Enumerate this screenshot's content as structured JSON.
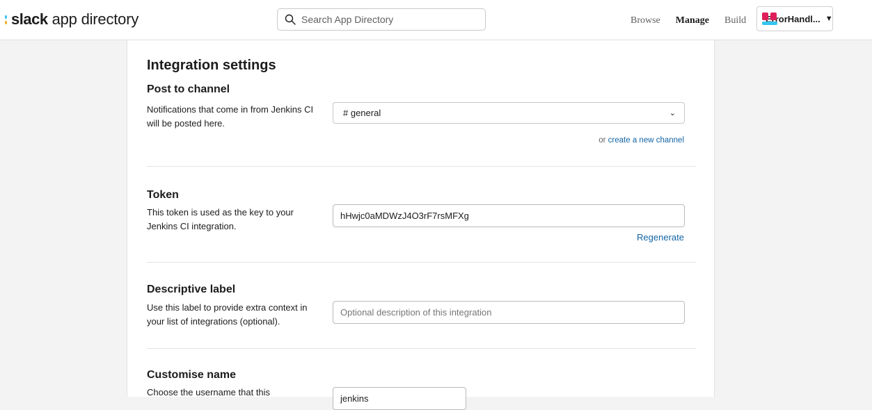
{
  "header": {
    "logo_word": "slack",
    "logo_sub": "app directory",
    "search_placeholder": "Search App Directory",
    "nav": [
      {
        "label": "Browse",
        "active": false
      },
      {
        "label": "Manage",
        "active": true
      },
      {
        "label": "Build",
        "active": false
      }
    ],
    "workspace_name": "ErrorHandl...",
    "workspace_caret": "▼"
  },
  "page": {
    "title": "Integration settings",
    "post_to_channel": {
      "title": "Post to channel",
      "description": "Notifications that come in from Jenkins CI will be posted here.",
      "selected_channel": "# general",
      "create_prefix": "or ",
      "create_link": "create a new channel"
    },
    "token": {
      "title": "Token",
      "description": "This token is used as the key to your Jenkins CI integration.",
      "value": "hHwjc0aMDWzJ4O3rF7rsMFXg",
      "regenerate": "Regenerate"
    },
    "descriptive_label": {
      "title": "Descriptive label",
      "description": "Use this label to provide extra context in your list of integrations (optional).",
      "placeholder": "Optional description of this integration"
    },
    "customise_name": {
      "title": "Customise name",
      "description": "Choose the username that this",
      "value": "jenkins"
    }
  },
  "colors": {
    "link": "#1264a3",
    "background": "#f3f3f3",
    "text": "#1d1c1d"
  }
}
